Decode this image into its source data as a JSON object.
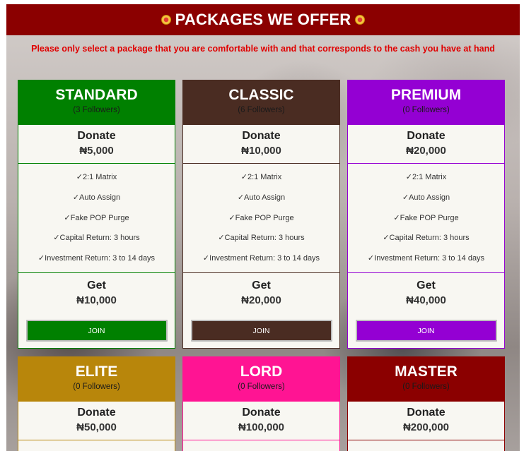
{
  "header": {
    "title": "PACKAGES WE OFFER",
    "icon": "coin-icon"
  },
  "notice": "Please only select a package that you are comfortable with and that corresponds to the cash you have at hand",
  "labels": {
    "donate": "Donate",
    "get": "Get",
    "join": "JOIN"
  },
  "features": [
    "✓2:1 Matrix",
    "✓Auto Assign",
    "✓Fake POP Purge",
    "✓Capital Return: 3 hours",
    "✓Investment Return: 3 to 14 days"
  ],
  "packages": [
    {
      "name": "STANDARD",
      "followers": "(3 Followers)",
      "donate": "₦5,000",
      "get": "₦10,000",
      "color": "#008000"
    },
    {
      "name": "CLASSIC",
      "followers": "(6 Followers)",
      "donate": "₦10,000",
      "get": "₦20,000",
      "color": "#4a2c22"
    },
    {
      "name": "PREMIUM",
      "followers": "(0 Followers)",
      "donate": "₦20,000",
      "get": "₦40,000",
      "color": "#9400d3"
    },
    {
      "name": "ELITE",
      "followers": "(0 Followers)",
      "donate": "₦50,000",
      "color": "#b8860b"
    },
    {
      "name": "LORD",
      "followers": "(0 Followers)",
      "donate": "₦100,000",
      "color": "#ff1493"
    },
    {
      "name": "MASTER",
      "followers": "(0 Followers)",
      "donate": "₦200,000",
      "color": "#8b0000"
    }
  ]
}
